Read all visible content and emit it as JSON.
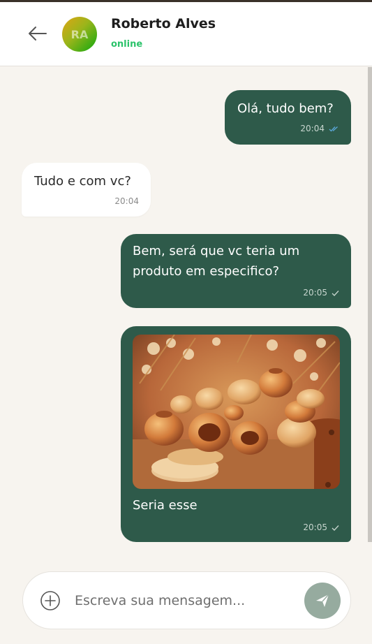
{
  "header": {
    "contact_name": "Roberto Alves",
    "status": "online",
    "avatar_initials": "RA",
    "back_icon": "arrow-left-icon"
  },
  "messages": [
    {
      "direction": "outgoing",
      "text": "Olá, tudo bem?",
      "time": "20:04",
      "status_icon": "double-check-icon"
    },
    {
      "direction": "incoming",
      "text": "Tudo e com vc?",
      "time": "20:04"
    },
    {
      "direction": "outgoing",
      "text": "Bem, será que vc teria um produto em especifico?",
      "time": "20:05",
      "status_icon": "check-icon"
    },
    {
      "direction": "outgoing",
      "type": "image",
      "image_description_icon": "pottery-photo",
      "text": "Seria esse",
      "time": "20:05",
      "status_icon": "check-icon"
    }
  ],
  "composer": {
    "placeholder": "Escreva sua mensagem...",
    "add_icon": "plus-circle-icon",
    "send_icon": "send-icon"
  },
  "colors": {
    "outgoing_bubble": "#2e5a4a",
    "incoming_bubble": "#ffffff",
    "background": "#f7f4ef",
    "status_online": "#2cc36b",
    "send_button": "#96ab9f",
    "read_check": "#5aa7d8"
  }
}
